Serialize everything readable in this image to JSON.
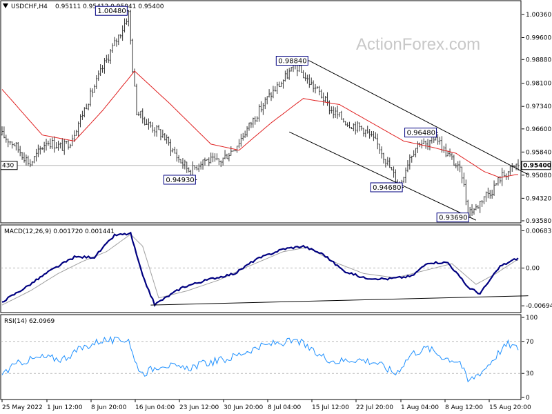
{
  "header": {
    "symbol": "USDCHF,H4",
    "ohlc": "0.95111 0.95412 0.95041 0.95400"
  },
  "watermark": "ActionForex.com",
  "colors": {
    "candle": "#333333",
    "ma": "#e02020",
    "macd_line": "#000080",
    "macd_signal": "#a0a0a0",
    "rsi": "#1e90ff",
    "channel": "#000000",
    "grid": "#b8b8b8"
  },
  "chart_data": [
    {
      "type": "candlestick",
      "panel": "price",
      "title": "USDCHF,H4",
      "ylim": [
        0.9358,
        1.007
      ],
      "y_ticks": [
        "1.00360",
        "0.99600",
        "0.98880",
        "0.98100",
        "0.97340",
        "0.96600",
        "0.95840",
        "0.95080",
        "0.94320",
        "0.93580"
      ],
      "current_price_label": "0.95400",
      "left_edge_label": "430",
      "x_ticks": [
        "25 May 2022",
        "1 Jun 12:00",
        "8 Jun 20:00",
        "16 Jun 04:00",
        "23 Jun 12:00",
        "30 Jun 20:00",
        "8 Jul 04:00",
        "15 Jul 12:00",
        "22 Jul 20:00",
        "1 Aug 04:00",
        "8 Aug 12:00",
        "15 Aug 20:00"
      ],
      "price_path_anchors": [
        {
          "i": 0,
          "v": 0.964
        },
        {
          "i": 6,
          "v": 0.961
        },
        {
          "i": 14,
          "v": 0.9545
        },
        {
          "i": 22,
          "v": 0.962
        },
        {
          "i": 30,
          "v": 0.96
        },
        {
          "i": 34,
          "v": 0.962
        },
        {
          "i": 42,
          "v": 0.974
        },
        {
          "i": 50,
          "v": 0.986
        },
        {
          "i": 56,
          "v": 0.994
        },
        {
          "i": 60,
          "v": 0.999
        },
        {
          "i": 63,
          "v": 1.004
        },
        {
          "i": 65,
          "v": 0.986
        },
        {
          "i": 67,
          "v": 0.972
        },
        {
          "i": 72,
          "v": 0.968
        },
        {
          "i": 80,
          "v": 0.964
        },
        {
          "i": 88,
          "v": 0.956
        },
        {
          "i": 94,
          "v": 0.952
        },
        {
          "i": 100,
          "v": 0.956
        },
        {
          "i": 108,
          "v": 0.955
        },
        {
          "i": 116,
          "v": 0.96
        },
        {
          "i": 124,
          "v": 0.968
        },
        {
          "i": 132,
          "v": 0.976
        },
        {
          "i": 140,
          "v": 0.982
        },
        {
          "i": 146,
          "v": 0.987
        },
        {
          "i": 152,
          "v": 0.982
        },
        {
          "i": 158,
          "v": 0.978
        },
        {
          "i": 164,
          "v": 0.972
        },
        {
          "i": 172,
          "v": 0.968
        },
        {
          "i": 180,
          "v": 0.966
        },
        {
          "i": 188,
          "v": 0.96
        },
        {
          "i": 194,
          "v": 0.952
        },
        {
          "i": 198,
          "v": 0.9475
        },
        {
          "i": 203,
          "v": 0.957
        },
        {
          "i": 208,
          "v": 0.962
        },
        {
          "i": 212,
          "v": 0.96
        },
        {
          "i": 216,
          "v": 0.964
        },
        {
          "i": 220,
          "v": 0.959
        },
        {
          "i": 224,
          "v": 0.956
        },
        {
          "i": 229,
          "v": 0.951
        },
        {
          "i": 232,
          "v": 0.939
        },
        {
          "i": 236,
          "v": 0.94
        },
        {
          "i": 240,
          "v": 0.944
        },
        {
          "i": 244,
          "v": 0.946
        },
        {
          "i": 248,
          "v": 0.95
        },
        {
          "i": 252,
          "v": 0.952
        },
        {
          "i": 256,
          "v": 0.954
        }
      ],
      "series": [
        {
          "name": "",
          "kind": "ma",
          "values_anchor": [
            {
              "i": 0,
              "v": 0.979
            },
            {
              "i": 20,
              "v": 0.964
            },
            {
              "i": 36,
              "v": 0.962
            },
            {
              "i": 50,
              "v": 0.972
            },
            {
              "i": 66,
              "v": 0.985
            },
            {
              "i": 84,
              "v": 0.974
            },
            {
              "i": 104,
              "v": 0.961
            },
            {
              "i": 118,
              "v": 0.959
            },
            {
              "i": 134,
              "v": 0.968
            },
            {
              "i": 150,
              "v": 0.976
            },
            {
              "i": 168,
              "v": 0.974
            },
            {
              "i": 184,
              "v": 0.968
            },
            {
              "i": 200,
              "v": 0.962
            },
            {
              "i": 214,
              "v": 0.96
            },
            {
              "i": 226,
              "v": 0.958
            },
            {
              "i": 240,
              "v": 0.952
            },
            {
              "i": 248,
              "v": 0.95
            },
            {
              "i": 256,
              "v": 0.951
            }
          ]
        }
      ],
      "annotations": [
        {
          "label": "1.00480",
          "i": 63,
          "v": 1.0048
        },
        {
          "label": "0.94930",
          "i": 97,
          "v": 0.9493
        },
        {
          "label": "0.98840",
          "i": 153,
          "v": 0.9884
        },
        {
          "label": "0.94680",
          "i": 200,
          "v": 0.9468
        },
        {
          "label": "0.96480",
          "i": 217,
          "v": 0.9648
        },
        {
          "label": "0.93690",
          "i": 233,
          "v": 0.9369
        }
      ],
      "trendlines": [
        {
          "from": {
            "i": 153,
            "v": 0.9884
          },
          "to": {
            "i": 262,
            "v": 0.951
          }
        },
        {
          "from": {
            "i": 143,
            "v": 0.965
          },
          "to": {
            "i": 236,
            "v": 0.936
          }
        }
      ]
    },
    {
      "type": "line",
      "panel": "macd",
      "title": "MACD(12,26,9) 0.001720 0.001441",
      "ylim": [
        -0.0078,
        0.0074
      ],
      "y_ticks": [
        "0.006837",
        "0.00",
        "-0.00694"
      ],
      "x_ticks": [
        "25 May 2022",
        "1 Jun 12:00",
        "8 Jun 20:00",
        "16 Jun 04:00",
        "23 Jun 12:00",
        "30 Jun 20:00",
        "8 Jul 04:00",
        "15 Jul 12:00",
        "22 Jul 20:00",
        "1 Aug 04:00",
        "8 Aug 12:00",
        "15 Aug 20:00"
      ],
      "series": [
        {
          "name": "",
          "kind": "macd",
          "values_anchor": [
            {
              "i": 0,
              "v": -0.0062
            },
            {
              "i": 12,
              "v": -0.0035
            },
            {
              "i": 24,
              "v": -0.0005
            },
            {
              "i": 36,
              "v": 0.002
            },
            {
              "i": 46,
              "v": 0.002
            },
            {
              "i": 56,
              "v": 0.006
            },
            {
              "i": 64,
              "v": 0.0063
            },
            {
              "i": 70,
              "v": -0.0015
            },
            {
              "i": 76,
              "v": -0.0067
            },
            {
              "i": 90,
              "v": -0.0035
            },
            {
              "i": 104,
              "v": -0.002
            },
            {
              "i": 116,
              "v": -0.001
            },
            {
              "i": 126,
              "v": 0.0015
            },
            {
              "i": 140,
              "v": 0.0035
            },
            {
              "i": 150,
              "v": 0.004
            },
            {
              "i": 160,
              "v": 0.0025
            },
            {
              "i": 170,
              "v": -0.0005
            },
            {
              "i": 180,
              "v": -0.0018
            },
            {
              "i": 192,
              "v": -0.002
            },
            {
              "i": 204,
              "v": -0.0015
            },
            {
              "i": 212,
              "v": 0.001
            },
            {
              "i": 222,
              "v": 0.001
            },
            {
              "i": 232,
              "v": -0.0035
            },
            {
              "i": 238,
              "v": -0.0047
            },
            {
              "i": 248,
              "v": 0.0003
            },
            {
              "i": 256,
              "v": 0.0017
            }
          ]
        },
        {
          "name": "",
          "kind": "signal",
          "values_anchor": [
            {
              "i": 0,
              "v": -0.0068
            },
            {
              "i": 14,
              "v": -0.0042
            },
            {
              "i": 28,
              "v": -0.001
            },
            {
              "i": 40,
              "v": 0.0012
            },
            {
              "i": 52,
              "v": 0.003
            },
            {
              "i": 64,
              "v": 0.0062
            },
            {
              "i": 70,
              "v": 0.004
            },
            {
              "i": 78,
              "v": -0.0055
            },
            {
              "i": 92,
              "v": -0.0042
            },
            {
              "i": 108,
              "v": -0.0022
            },
            {
              "i": 122,
              "v": 0.0002
            },
            {
              "i": 140,
              "v": 0.003
            },
            {
              "i": 152,
              "v": 0.0038
            },
            {
              "i": 166,
              "v": 0.001
            },
            {
              "i": 180,
              "v": -0.001
            },
            {
              "i": 196,
              "v": -0.0018
            },
            {
              "i": 210,
              "v": -0.0005
            },
            {
              "i": 224,
              "v": 0.0008
            },
            {
              "i": 236,
              "v": -0.003
            },
            {
              "i": 246,
              "v": -0.001
            },
            {
              "i": 256,
              "v": 0.0014
            }
          ]
        }
      ],
      "trendlines": [
        {
          "from": {
            "i": 74,
            "v": -0.0068
          },
          "to": {
            "i": 262,
            "v": -0.0051
          }
        }
      ]
    },
    {
      "type": "line",
      "panel": "rsi",
      "title": "RSI(14) 62.0969",
      "ylim": [
        0,
        100
      ],
      "y_ticks": [
        "100",
        "70",
        "30",
        "0"
      ],
      "x_ticks": [
        "25 May 2022",
        "1 Jun 12:00",
        "8 Jun 20:00",
        "16 Jun 04:00",
        "23 Jun 12:00",
        "30 Jun 20:00",
        "8 Jul 04:00",
        "15 Jul 12:00",
        "22 Jul 20:00",
        "1 Aug 04:00",
        "8 Aug 12:00",
        "15 Aug 20:00"
      ],
      "series": [
        {
          "name": "",
          "kind": "rsi",
          "values_anchor": [
            {
              "i": 0,
              "v": 30
            },
            {
              "i": 10,
              "v": 45
            },
            {
              "i": 20,
              "v": 50
            },
            {
              "i": 30,
              "v": 48
            },
            {
              "i": 40,
              "v": 62
            },
            {
              "i": 50,
              "v": 72
            },
            {
              "i": 58,
              "v": 70
            },
            {
              "i": 63,
              "v": 74
            },
            {
              "i": 66,
              "v": 45
            },
            {
              "i": 70,
              "v": 30
            },
            {
              "i": 80,
              "v": 42
            },
            {
              "i": 90,
              "v": 35
            },
            {
              "i": 100,
              "v": 42
            },
            {
              "i": 112,
              "v": 48
            },
            {
              "i": 124,
              "v": 60
            },
            {
              "i": 136,
              "v": 68
            },
            {
              "i": 148,
              "v": 70
            },
            {
              "i": 156,
              "v": 55
            },
            {
              "i": 166,
              "v": 45
            },
            {
              "i": 176,
              "v": 48
            },
            {
              "i": 186,
              "v": 44
            },
            {
              "i": 196,
              "v": 30
            },
            {
              "i": 204,
              "v": 55
            },
            {
              "i": 212,
              "v": 62
            },
            {
              "i": 220,
              "v": 50
            },
            {
              "i": 228,
              "v": 45
            },
            {
              "i": 232,
              "v": 20
            },
            {
              "i": 240,
              "v": 35
            },
            {
              "i": 248,
              "v": 58
            },
            {
              "i": 252,
              "v": 67
            },
            {
              "i": 256,
              "v": 62
            }
          ]
        }
      ]
    }
  ]
}
